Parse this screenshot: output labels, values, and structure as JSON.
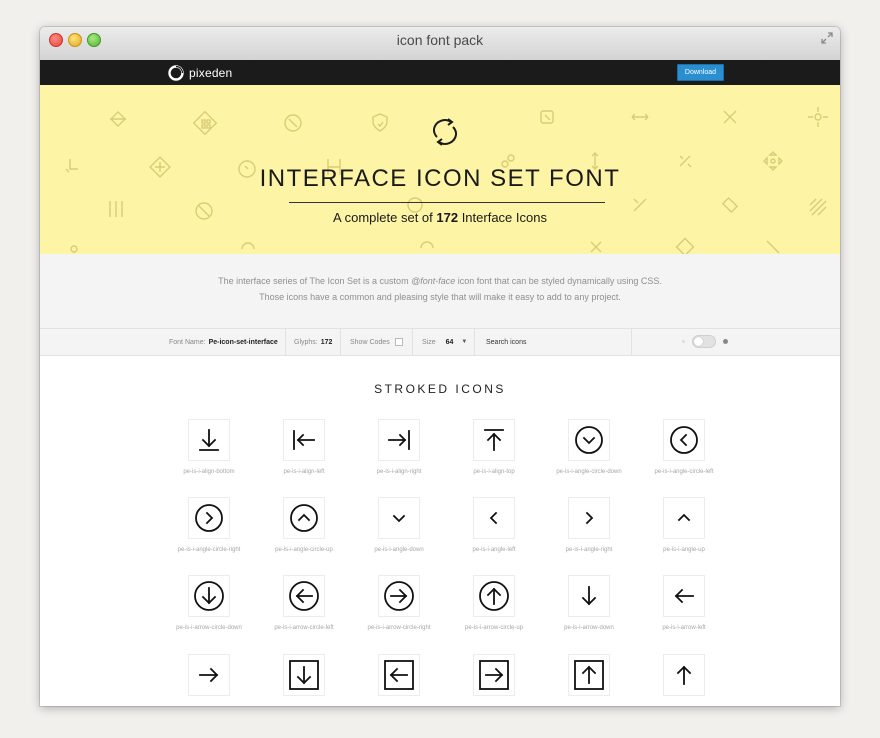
{
  "window": {
    "title": "icon font pack"
  },
  "navbar": {
    "brand": "pixeden",
    "download_label": "Download"
  },
  "hero": {
    "title": "INTERFACE ICON SET FONT",
    "subtitle_prefix": "A complete set of ",
    "subtitle_count": "172",
    "subtitle_suffix": " Interface Icons"
  },
  "intro": {
    "line1_a": "The interface series of The Icon Set is a custom ",
    "line1_em": "@font-face",
    "line1_b": " icon font that can be styled dynamically using CSS.",
    "line2": "Those icons have a common and pleasing style that will make it easy to add to any project."
  },
  "toolbar": {
    "font_name_label": "Font Name:",
    "font_name_value": "Pe-icon-set-interface",
    "glyphs_label": "Glyphs:",
    "glyphs_value": "172",
    "show_codes_label": "Show Codes",
    "size_label": "Size",
    "size_value": "64",
    "search_placeholder": "Search icons"
  },
  "section": {
    "title": "STROKED ICONS"
  },
  "icons": [
    {
      "name": "pe-is-i-align-bottom",
      "glyph": "align-bottom"
    },
    {
      "name": "pe-is-i-align-left",
      "glyph": "align-left"
    },
    {
      "name": "pe-is-i-align-right",
      "glyph": "align-right"
    },
    {
      "name": "pe-is-i-align-top",
      "glyph": "align-top"
    },
    {
      "name": "pe-is-i-angle-circle-down",
      "glyph": "angle-circle-down"
    },
    {
      "name": "pe-is-i-angle-circle-left",
      "glyph": "angle-circle-left"
    },
    {
      "name": "pe-is-i-angle-circle-right",
      "glyph": "angle-circle-right"
    },
    {
      "name": "pe-is-i-angle-circle-up",
      "glyph": "angle-circle-up"
    },
    {
      "name": "pe-is-i-angle-down",
      "glyph": "angle-down"
    },
    {
      "name": "pe-is-i-angle-left",
      "glyph": "angle-left"
    },
    {
      "name": "pe-is-i-angle-right",
      "glyph": "angle-right"
    },
    {
      "name": "pe-is-i-angle-up",
      "glyph": "angle-up"
    },
    {
      "name": "pe-is-i-arrow-circle-down",
      "glyph": "arrow-circle-down"
    },
    {
      "name": "pe-is-i-arrow-circle-left",
      "glyph": "arrow-circle-left"
    },
    {
      "name": "pe-is-i-arrow-circle-right",
      "glyph": "arrow-circle-right"
    },
    {
      "name": "pe-is-i-arrow-circle-up",
      "glyph": "arrow-circle-up"
    },
    {
      "name": "pe-is-i-arrow-down",
      "glyph": "arrow-down"
    },
    {
      "name": "pe-is-i-arrow-left",
      "glyph": "arrow-left"
    },
    {
      "name": "",
      "glyph": "arrow-right"
    },
    {
      "name": "",
      "glyph": "arrow-square-down"
    },
    {
      "name": "",
      "glyph": "arrow-square-left"
    },
    {
      "name": "",
      "glyph": "arrow-square-right"
    },
    {
      "name": "",
      "glyph": "arrow-square-up"
    },
    {
      "name": "",
      "glyph": "arrow-up"
    }
  ],
  "colors": {
    "hero_bg": "#fdf5a5",
    "navbar_bg": "#1b1b1b",
    "accent": "#2a8fd0"
  }
}
